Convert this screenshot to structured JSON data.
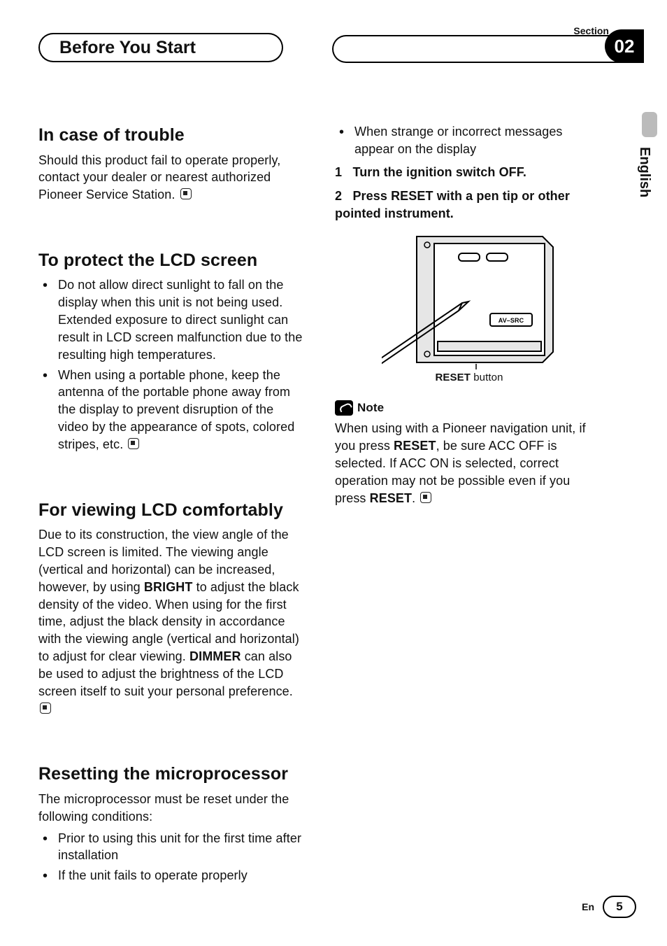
{
  "header": {
    "chapter": "Before You Start",
    "section_label": "Section",
    "section_number": "02"
  },
  "language_tab": "English",
  "footer": {
    "lang_code": "En",
    "page_number": "5"
  },
  "left": {
    "trouble": {
      "heading": "In case of trouble",
      "body": "Should this product fail to operate properly, contact your dealer or nearest authorized Pioneer Service Station."
    },
    "protect": {
      "heading": "To protect the LCD screen",
      "bullets": [
        "Do not allow direct sunlight to fall on the display when this unit is not being used. Extended exposure to direct sunlight can result in LCD screen malfunction due to the resulting high temperatures.",
        "When using a portable phone, keep the antenna of the portable phone away from the display to prevent disruption of the video by the appearance of spots, colored stripes, etc."
      ]
    },
    "viewing": {
      "heading": "For viewing LCD comfortably",
      "body_1": "Due to its construction, the view angle of the LCD screen is limited. The viewing angle (vertical and horizontal) can be increased, however, by using ",
      "bold_1": "BRIGHT",
      "body_2": " to adjust the black density of the video. When using for the first time, adjust the black density in accordance with the viewing angle (vertical and horizontal) to adjust for clear viewing. ",
      "bold_2": "DIMMER",
      "body_3": " can also be used to adjust the brightness of the LCD screen itself to suit your personal preference."
    },
    "reset": {
      "heading": "Resetting the microprocessor",
      "intro": "The microprocessor must be reset under the following conditions:",
      "bullets": [
        "Prior to using this unit for the first time after installation",
        "If the unit fails to operate properly"
      ]
    }
  },
  "right": {
    "extra_bullet": "When strange or incorrect messages appear on the display",
    "step1": {
      "num": "1",
      "text": "Turn the ignition switch OFF."
    },
    "step2": {
      "num": "2",
      "text": "Press RESET with a pen tip or other pointed instrument."
    },
    "figure_caption_bold": "RESET",
    "figure_caption_rest": " button",
    "figure_label": "AV–SRC",
    "note": {
      "title": "Note",
      "body_1": "When using with a Pioneer navigation unit, if you press ",
      "bold_1": "RESET",
      "body_2": ", be sure ACC OFF is selected. If ACC ON is selected, correct operation may not be possible even if you press ",
      "bold_2": "RESET",
      "body_3": "."
    }
  }
}
